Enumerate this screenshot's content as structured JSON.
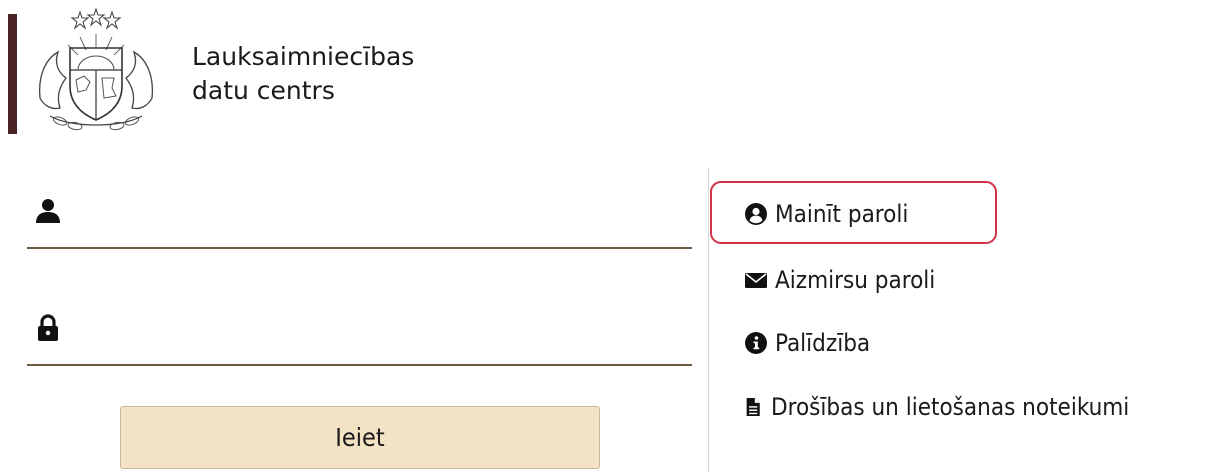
{
  "header": {
    "org_name_line1": "Lauksaimniecības",
    "org_name_line2": "datu centrs",
    "logo_icon": "latvia-coat-of-arms-icon",
    "brand_color": "#4a2424"
  },
  "login_form": {
    "username": {
      "icon": "user-icon",
      "value": "",
      "placeholder": ""
    },
    "password": {
      "icon": "lock-icon",
      "value": "",
      "placeholder": ""
    },
    "submit_label": "Ieiet",
    "submit_color": "#f3e2c4"
  },
  "links": [
    {
      "label": "Mainīt paroli",
      "icon": "user-circle-icon",
      "highlighted": true
    },
    {
      "label": "Aizmirsu paroli",
      "icon": "envelope-icon"
    },
    {
      "label": "Palīdzība",
      "icon": "info-circle-icon"
    },
    {
      "label": "Drošības un lietošanas noteikumi",
      "icon": "document-icon"
    }
  ],
  "highlight_color": "#d0334a"
}
